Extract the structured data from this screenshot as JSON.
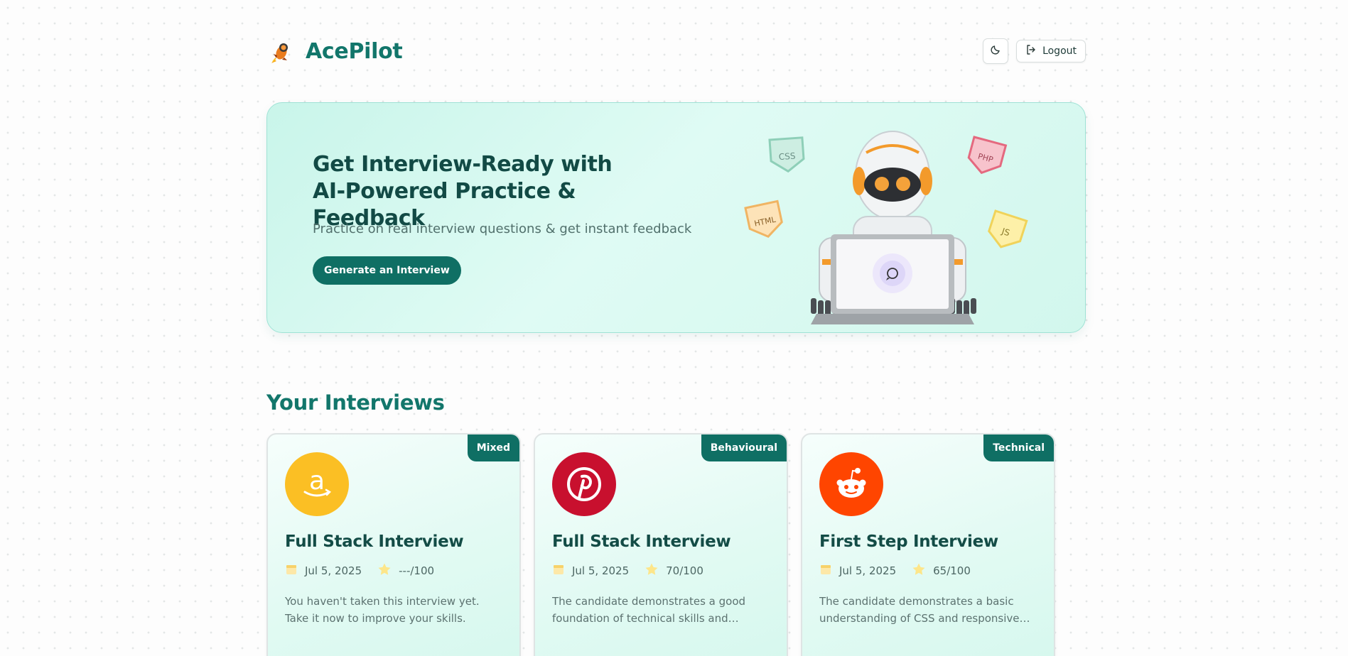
{
  "app": {
    "name": "AcePilot",
    "logout_label": "Logout",
    "theme_icon": "moon-icon",
    "accent": "#12766b"
  },
  "hero": {
    "title": "Get Interview-Ready with AI-Powered Practice & Feedback",
    "subtitle": "Practice on real interview questions & get instant feedback",
    "cta_label": "Generate an Interview",
    "tags": [
      "CSS",
      "PHP",
      "HTML",
      "JS"
    ]
  },
  "interviews": {
    "section_title": "Your Interviews",
    "cards": [
      {
        "badge": "Mixed",
        "logo": "amazon-logo",
        "logo_color": "#fbbf24",
        "title": "Full Stack Interview",
        "date": "Jul 5, 2025",
        "score": "---/100",
        "description": "You haven't taken this interview yet. Take it now to improve your skills."
      },
      {
        "badge": "Behavioural",
        "logo": "pinterest-logo",
        "logo_color": "#c8102e",
        "title": "Full Stack Interview",
        "date": "Jul 5, 2025",
        "score": "70/100",
        "description": "The candidate demonstrates a good foundation of technical skills and…"
      },
      {
        "badge": "Technical",
        "logo": "reddit-logo",
        "logo_color": "#ff4500",
        "title": "First Step Interview",
        "date": "Jul 5, 2025",
        "score": "65/100",
        "description": "The candidate demonstrates a basic understanding of CSS and responsive…"
      }
    ]
  }
}
